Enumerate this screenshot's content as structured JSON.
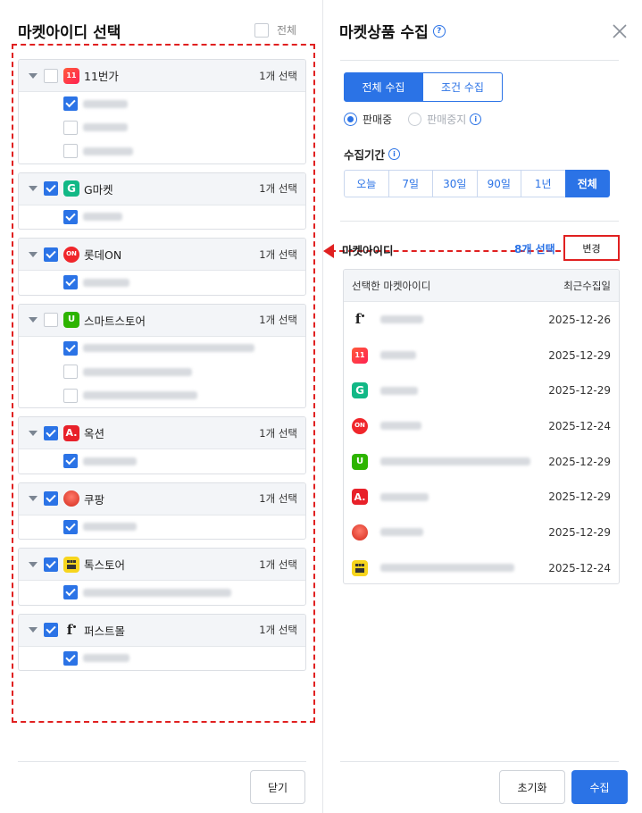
{
  "left": {
    "title": "마켓아이디 선택",
    "select_all_label": "전체",
    "select_all_checked": false,
    "groups": [
      {
        "id": "11st",
        "icon": "11st-logo-icon",
        "name": "11번가",
        "count": "1개 선택",
        "checked": false,
        "accounts": [
          {
            "checked": true,
            "w": 50
          },
          {
            "checked": false,
            "w": 50
          },
          {
            "checked": false,
            "w": 56
          }
        ]
      },
      {
        "id": "gmarket",
        "icon": "gmarket-logo-icon",
        "name": "G마켓",
        "count": "1개 선택",
        "checked": true,
        "accounts": [
          {
            "checked": true,
            "w": 44
          }
        ]
      },
      {
        "id": "lotteon",
        "icon": "lotteon-logo-icon",
        "name": "롯데ON",
        "count": "1개 선택",
        "checked": true,
        "accounts": [
          {
            "checked": true,
            "w": 52
          }
        ]
      },
      {
        "id": "smartstore",
        "icon": "smartstore-logo-icon",
        "name": "스마트스토어",
        "count": "1개 선택",
        "checked": false,
        "accounts": [
          {
            "checked": true,
            "w": 192
          },
          {
            "checked": false,
            "w": 122
          },
          {
            "checked": false,
            "w": 128
          }
        ]
      },
      {
        "id": "auction",
        "icon": "auction-logo-icon",
        "name": "옥션",
        "count": "1개 선택",
        "checked": true,
        "accounts": [
          {
            "checked": true,
            "w": 60
          }
        ]
      },
      {
        "id": "coupang",
        "icon": "coupang-logo-icon",
        "name": "쿠팡",
        "count": "1개 선택",
        "checked": true,
        "accounts": [
          {
            "checked": true,
            "w": 60
          }
        ]
      },
      {
        "id": "tokstore",
        "icon": "tokstore-logo-icon",
        "name": "톡스토어",
        "count": "1개 선택",
        "checked": true,
        "accounts": [
          {
            "checked": true,
            "w": 166
          }
        ]
      },
      {
        "id": "firstmall",
        "icon": "firstmall-logo-icon",
        "name": "퍼스트몰",
        "count": "1개 선택",
        "checked": true,
        "accounts": [
          {
            "checked": true,
            "w": 52
          }
        ]
      }
    ],
    "close_label": "닫기"
  },
  "right": {
    "title": "마켓상품 수집",
    "mode_tabs": [
      {
        "label": "전체 수집",
        "active": true
      },
      {
        "label": "조건 수집",
        "active": false
      }
    ],
    "status_options": [
      {
        "label": "판매중",
        "selected": true,
        "disabled": false
      },
      {
        "label": "판매중지",
        "selected": false,
        "disabled": true
      }
    ],
    "period_label": "수집기간",
    "period_tabs": [
      {
        "label": "오늘",
        "active": false
      },
      {
        "label": "7일",
        "active": false
      },
      {
        "label": "30일",
        "active": false
      },
      {
        "label": "90일",
        "active": false
      },
      {
        "label": "1년",
        "active": false
      },
      {
        "label": "전체",
        "active": true
      }
    ],
    "market_id_label": "마켓아이디",
    "selected_count": "8개 선택",
    "change_label": "변경",
    "table_headers": {
      "account": "선택한 마켓아이디",
      "date": "최근수집일"
    },
    "rows": [
      {
        "icon": "firstmall-logo-icon",
        "w": 48,
        "date": "2025-12-26"
      },
      {
        "icon": "11st-logo-icon",
        "w": 40,
        "date": "2025-12-29"
      },
      {
        "icon": "gmarket-logo-icon",
        "w": 42,
        "date": "2025-12-29"
      },
      {
        "icon": "lotteon-logo-icon",
        "w": 46,
        "date": "2025-12-24"
      },
      {
        "icon": "smartstore-logo-icon",
        "w": 168,
        "date": "2025-12-29"
      },
      {
        "icon": "auction-logo-icon",
        "w": 54,
        "date": "2025-12-29"
      },
      {
        "icon": "coupang-logo-icon",
        "w": 48,
        "date": "2025-12-29"
      },
      {
        "icon": "tokstore-logo-icon",
        "w": 150,
        "date": "2025-12-24"
      }
    ],
    "reset_label": "초기화",
    "collect_label": "수집"
  },
  "colors": {
    "accent": "#2b73e6",
    "annotation": "#e02020"
  }
}
